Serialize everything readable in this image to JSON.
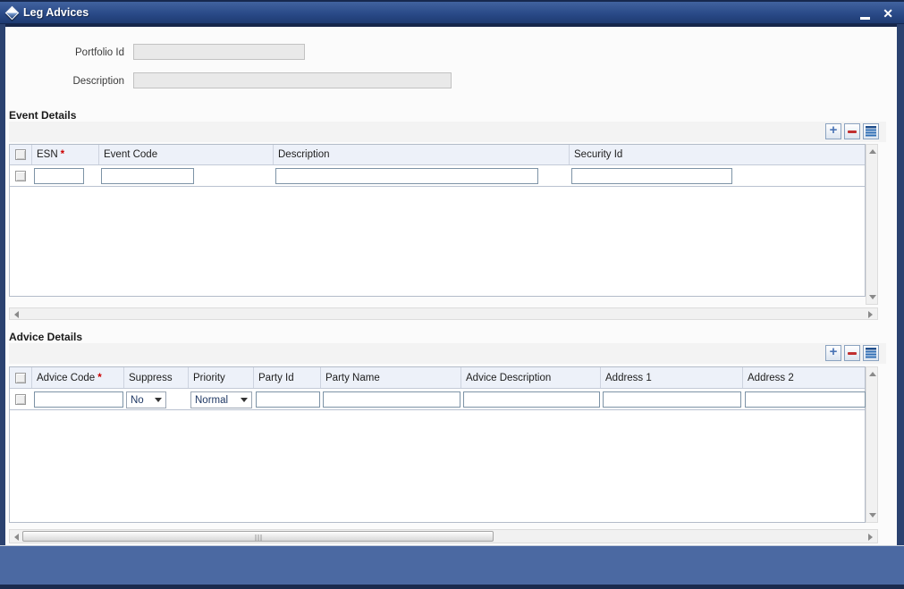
{
  "window": {
    "title": "Leg Advices"
  },
  "form": {
    "portfolio_id": {
      "label": "Portfolio Id",
      "value": ""
    },
    "description": {
      "label": "Description",
      "value": ""
    }
  },
  "event_details": {
    "title": "Event Details",
    "columns": [
      {
        "label": "ESN",
        "required": "*"
      },
      {
        "label": "Event Code",
        "required": ""
      },
      {
        "label": "Description",
        "required": ""
      },
      {
        "label": "Security Id",
        "required": ""
      }
    ],
    "row": {
      "esn": "",
      "event_code": "",
      "description": "",
      "security_id": ""
    }
  },
  "advice_details": {
    "title": "Advice Details",
    "columns": [
      {
        "label": "Advice Code",
        "required": "*"
      },
      {
        "label": "Suppress",
        "required": ""
      },
      {
        "label": "Priority",
        "required": ""
      },
      {
        "label": "Party Id",
        "required": ""
      },
      {
        "label": "Party Name",
        "required": ""
      },
      {
        "label": "Advice Description",
        "required": ""
      },
      {
        "label": "Address 1",
        "required": ""
      },
      {
        "label": "Address 2",
        "required": ""
      }
    ],
    "row": {
      "advice_code": "",
      "suppress": "No",
      "priority": "Normal",
      "party_id": "",
      "party_name": "",
      "advice_description": "",
      "address_1": "",
      "address_2": ""
    }
  },
  "icons": {
    "titlebar": "diamond-icon",
    "minimize": "minimize-icon",
    "close": "close-icon",
    "add": "plus-icon",
    "remove": "minus-icon",
    "single_view": "single-view-icon"
  },
  "colors": {
    "titlebar_top": "#41639f",
    "titlebar_bottom": "#1e3b72",
    "frame": "#2b4270",
    "footer": "#4b69a2",
    "grid_header_bg": "#edf1f9",
    "required_red": "#cc0000",
    "select_text": "#1f3864"
  }
}
